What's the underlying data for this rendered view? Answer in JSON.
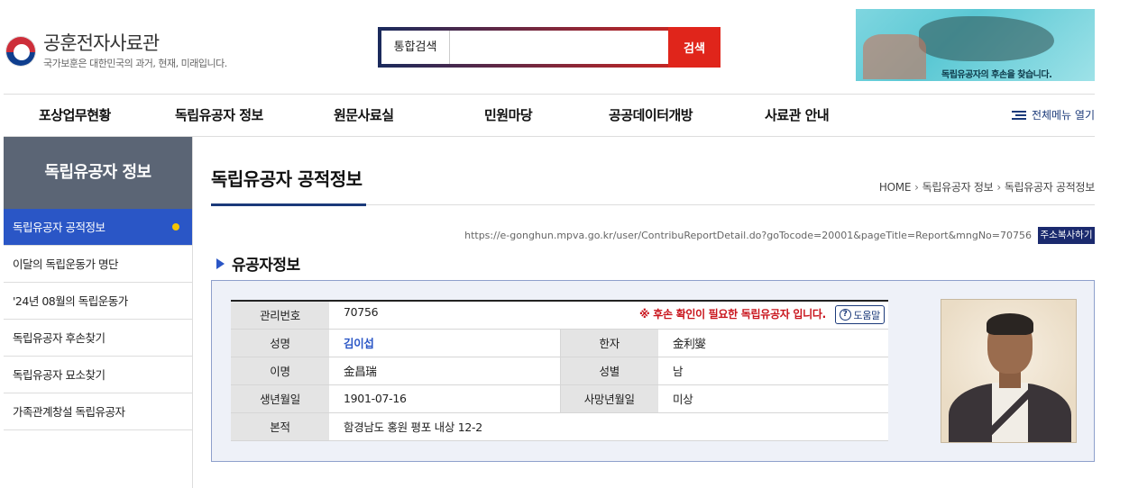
{
  "header": {
    "logo_title": "공훈전자사료관",
    "logo_sub": "국가보훈은 대한민국의 과거, 현재, 미래입니다.",
    "search_label": "통합검색",
    "search_value": "",
    "search_button": "검색",
    "banner_caption": "독립유공자의 후손을 찾습니다."
  },
  "nav": {
    "items": [
      "포상업무현황",
      "독립유공자 정보",
      "원문사료실",
      "민원마당",
      "공공데이터개방",
      "사료관 안내"
    ],
    "all_menu": "전체메뉴 열기"
  },
  "sidebar": {
    "title": "독립유공자 정보",
    "items": [
      "독립유공자 공적정보",
      "이달의 독립운동가 명단",
      "'24년 08월의 독립운동가",
      "독립유공자 후손찾기",
      "독립유공자 묘소찾기",
      "가족관계창설 독립유공자"
    ]
  },
  "main": {
    "title": "독립유공자 공적정보",
    "breadcrumb": [
      "HOME",
      "독립유공자 정보",
      "독립유공자 공적정보"
    ],
    "url": "https://e-gonghun.mpva.go.kr/user/ContribuReportDetail.do?goTocode=20001&pageTitle=Report&mngNo=70756",
    "copy_button": "주소복사하기",
    "section_title": "유공자정보"
  },
  "info": {
    "label_mgmt": "관리번호",
    "mgmt_no": "70756",
    "notice": "※ 후손 확인이 필요한 독립유공자 입니다.",
    "help": "도움말",
    "label_name": "성명",
    "name": "김이섭",
    "label_hanja": "한자",
    "hanja": "金利燮",
    "label_alias": "이명",
    "alias": "金昌瑞",
    "label_gender": "성별",
    "gender": "남",
    "label_birth": "생년월일",
    "birth": "1901-07-16",
    "label_death": "사망년월일",
    "death": "미상",
    "label_origin": "본적",
    "origin": "함경남도 홍원 평포 내상 12-2"
  }
}
